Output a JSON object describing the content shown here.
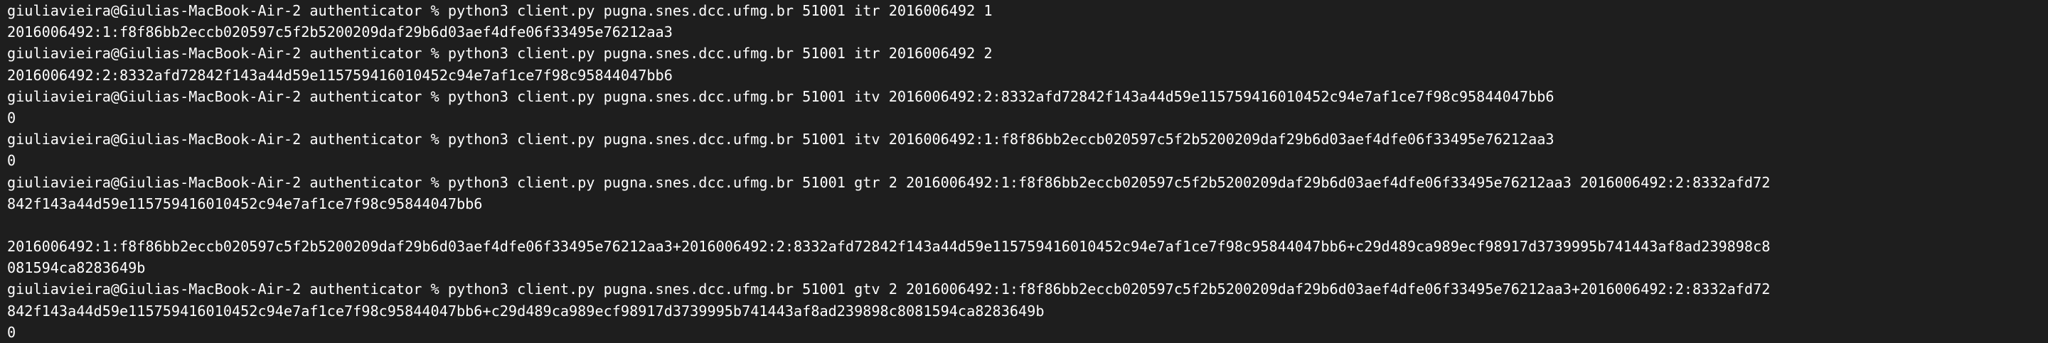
{
  "terminal": {
    "lines": [
      {
        "text": "giuliavieira@Giulias-MacBook-Air-2 authenticator % python3 client.py pugna.snes.dcc.ufmg.br 51001 itr 2016006492 1",
        "mark": true
      },
      {
        "text": "2016006492:1:f8f86bb2eccb020597c5f2b5200209daf29b6d03aef4dfe06f33495e76212aa3",
        "mark": false
      },
      {
        "text": "giuliavieira@Giulias-MacBook-Air-2 authenticator % python3 client.py pugna.snes.dcc.ufmg.br 51001 itr 2016006492 2",
        "mark": true
      },
      {
        "text": "2016006492:2:8332afd72842f143a44d59e115759416010452c94e7af1ce7f98c95844047bb6",
        "mark": false
      },
      {
        "text": "giuliavieira@Giulias-MacBook-Air-2 authenticator % python3 client.py pugna.snes.dcc.ufmg.br 51001 itv 2016006492:2:8332afd72842f143a44d59e115759416010452c94e7af1ce7f98c95844047bb6",
        "mark": true
      },
      {
        "text": "0",
        "mark": false
      },
      {
        "text": "giuliavieira@Giulias-MacBook-Air-2 authenticator % python3 client.py pugna.snes.dcc.ufmg.br 51001 itv 2016006492:1:f8f86bb2eccb020597c5f2b5200209daf29b6d03aef4dfe06f33495e76212aa3",
        "mark": true
      },
      {
        "text": "0",
        "mark": false
      },
      {
        "text": "giuliavieira@Giulias-MacBook-Air-2 authenticator % python3 client.py pugna.snes.dcc.ufmg.br 51001 gtr 2 2016006492:1:f8f86bb2eccb020597c5f2b5200209daf29b6d03aef4dfe06f33495e76212aa3 2016006492:2:8332afd72",
        "mark": true
      },
      {
        "text": "842f143a44d59e115759416010452c94e7af1ce7f98c95844047bb6",
        "mark": false
      },
      {
        "text": "",
        "mark": true
      },
      {
        "text": "2016006492:1:f8f86bb2eccb020597c5f2b5200209daf29b6d03aef4dfe06f33495e76212aa3+2016006492:2:8332afd72842f143a44d59e115759416010452c94e7af1ce7f98c95844047bb6+c29d489ca989ecf98917d3739995b741443af8ad239898c8",
        "mark": false
      },
      {
        "text": "081594ca8283649b",
        "mark": false
      },
      {
        "text": "giuliavieira@Giulias-MacBook-Air-2 authenticator % python3 client.py pugna.snes.dcc.ufmg.br 51001 gtv 2 2016006492:1:f8f86bb2eccb020597c5f2b5200209daf29b6d03aef4dfe06f33495e76212aa3+2016006492:2:8332afd72",
        "mark": true
      },
      {
        "text": "842f143a44d59e115759416010452c94e7af1ce7f98c95844047bb6+c29d489ca989ecf98917d3739995b741443af8ad239898c8081594ca8283649b",
        "mark": false
      },
      {
        "text": "0",
        "mark": false
      }
    ]
  }
}
